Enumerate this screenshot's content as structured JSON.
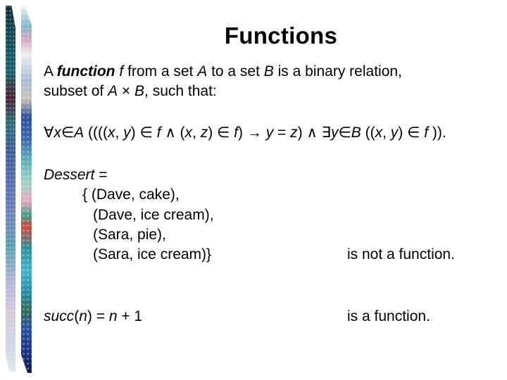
{
  "slide": {
    "title": "Functions",
    "definition": {
      "line1": {
        "p1": "A ",
        "term": "function",
        "p2": " ",
        "f": "f",
        "p3": " from a set ",
        "A": "A",
        "p4": " to a set ",
        "B": "B",
        "p5": " is a binary relation,"
      },
      "line2": {
        "p1": "subset of ",
        "A": "A",
        "times": " × ",
        "B": "B",
        "p2": ", such that:"
      }
    },
    "formula": {
      "forall": "∀",
      "x": "x",
      "in1": "∈",
      "A": "A",
      "s1": " ((((",
      "x2": "x",
      "s2": ", ",
      "y1": "y",
      "s3": ") ∈ ",
      "f1": "f",
      "s4": " ∧ (",
      "x3": "x",
      "s5": ", ",
      "z1": "z",
      "s6": ") ∈ ",
      "f2": "f",
      "s7": ") → ",
      "y2": "y",
      "s8": " = ",
      "z2": "z",
      "s9": ") ∧ ∃",
      "y3": "y",
      "in2": "∈",
      "B": "B",
      "s10": " ((",
      "x4": "x",
      "s11": ", ",
      "y4": "y",
      "s12": ") ∈ ",
      "f3": "f",
      "s13": " ))."
    },
    "dessert": {
      "name": "Dessert",
      "eq": " =",
      "lines": [
        "{ (Dave, cake),",
        "(Dave, ice cream),",
        "(Sara, pie),",
        "(Sara, ice cream)}"
      ],
      "verdict": "is not a function."
    },
    "succ": {
      "fn": "succ",
      "p1": "(",
      "n1": "n",
      "p2": ") = ",
      "n2": "n",
      "p3": " + 1",
      "verdict": "is a function."
    }
  }
}
